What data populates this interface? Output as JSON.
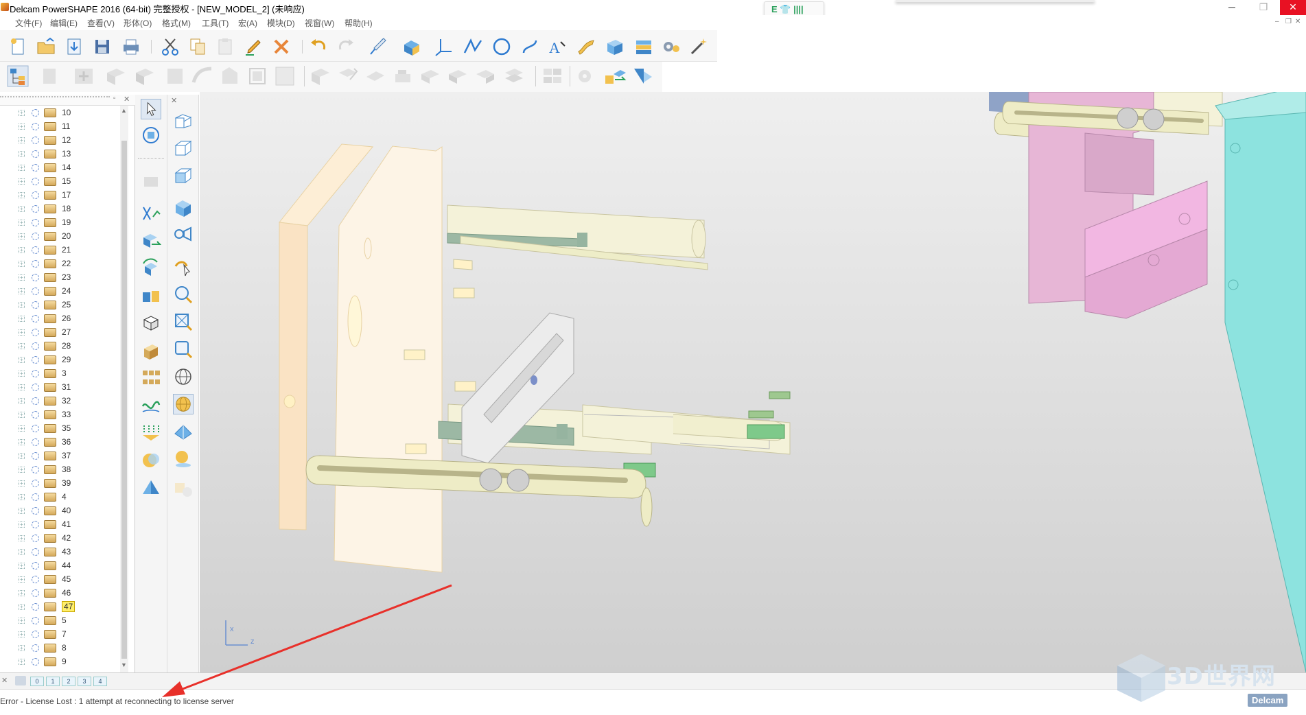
{
  "window": {
    "title": "Delcam PowerSHAPE 2016 (64-bit) 完整授权 - [NEW_MODEL_2] (未响应)",
    "minimize": "─",
    "maximize": "❐",
    "close": "✕"
  },
  "ime": {
    "label": "E 👕 ||||"
  },
  "menu": {
    "items": [
      "文件(F)",
      "编辑(E)",
      "查看(V)",
      "形体(O)",
      "格式(M)",
      "工具(T)",
      "宏(A)",
      "模块(D)",
      "视窗(W)",
      "帮助(H)"
    ],
    "mdi_min": "–",
    "mdi_restore": "❐",
    "mdi_close": "✕"
  },
  "tree": {
    "items": [
      "10",
      "11",
      "12",
      "13",
      "14",
      "15",
      "17",
      "18",
      "19",
      "20",
      "21",
      "22",
      "23",
      "24",
      "25",
      "26",
      "27",
      "28",
      "29",
      "3",
      "31",
      "32",
      "33",
      "35",
      "36",
      "37",
      "38",
      "39",
      "4",
      "40",
      "41",
      "42",
      "43",
      "44",
      "45",
      "46",
      "47",
      "5",
      "7",
      "8",
      "9"
    ],
    "highlighted": "47"
  },
  "levels": [
    "0",
    "1",
    "2",
    "3",
    "4"
  ],
  "status": {
    "text": "Error - License Lost : 1 attempt at reconnecting to license server",
    "brand": "Delcam"
  },
  "axis": {
    "x": "x",
    "z": "z"
  },
  "watermark": {
    "text": "3D世界网"
  },
  "colors": {
    "close": "#e81123",
    "highlight": "#ffef6b",
    "arrow": "#e8302a"
  }
}
